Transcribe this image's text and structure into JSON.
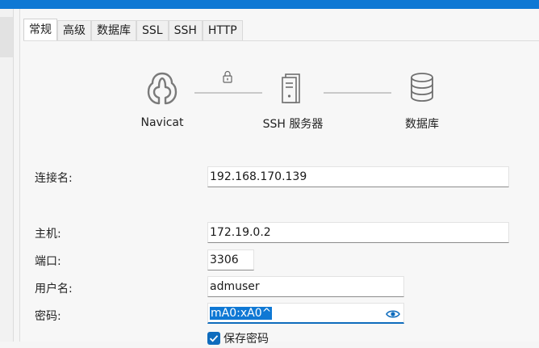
{
  "tabs": [
    "常规",
    "高级",
    "数据库",
    "SSL",
    "SSH",
    "HTTP"
  ],
  "diagram": {
    "source": "Navicat",
    "middle": "SSH 服务器",
    "target": "数据库"
  },
  "form": {
    "connection_name_label": "连接名:",
    "connection_name_value": "192.168.170.139",
    "host_label": "主机:",
    "host_value": "172.19.0.2",
    "port_label": "端口:",
    "port_value": "3306",
    "user_label": "用户名:",
    "user_value": "admuser",
    "password_label": "密码:",
    "password_value": "mA0:xA0^",
    "save_password_label": "保存密码",
    "save_password_checked": true
  },
  "colors": {
    "accent": "#0f78d4"
  }
}
